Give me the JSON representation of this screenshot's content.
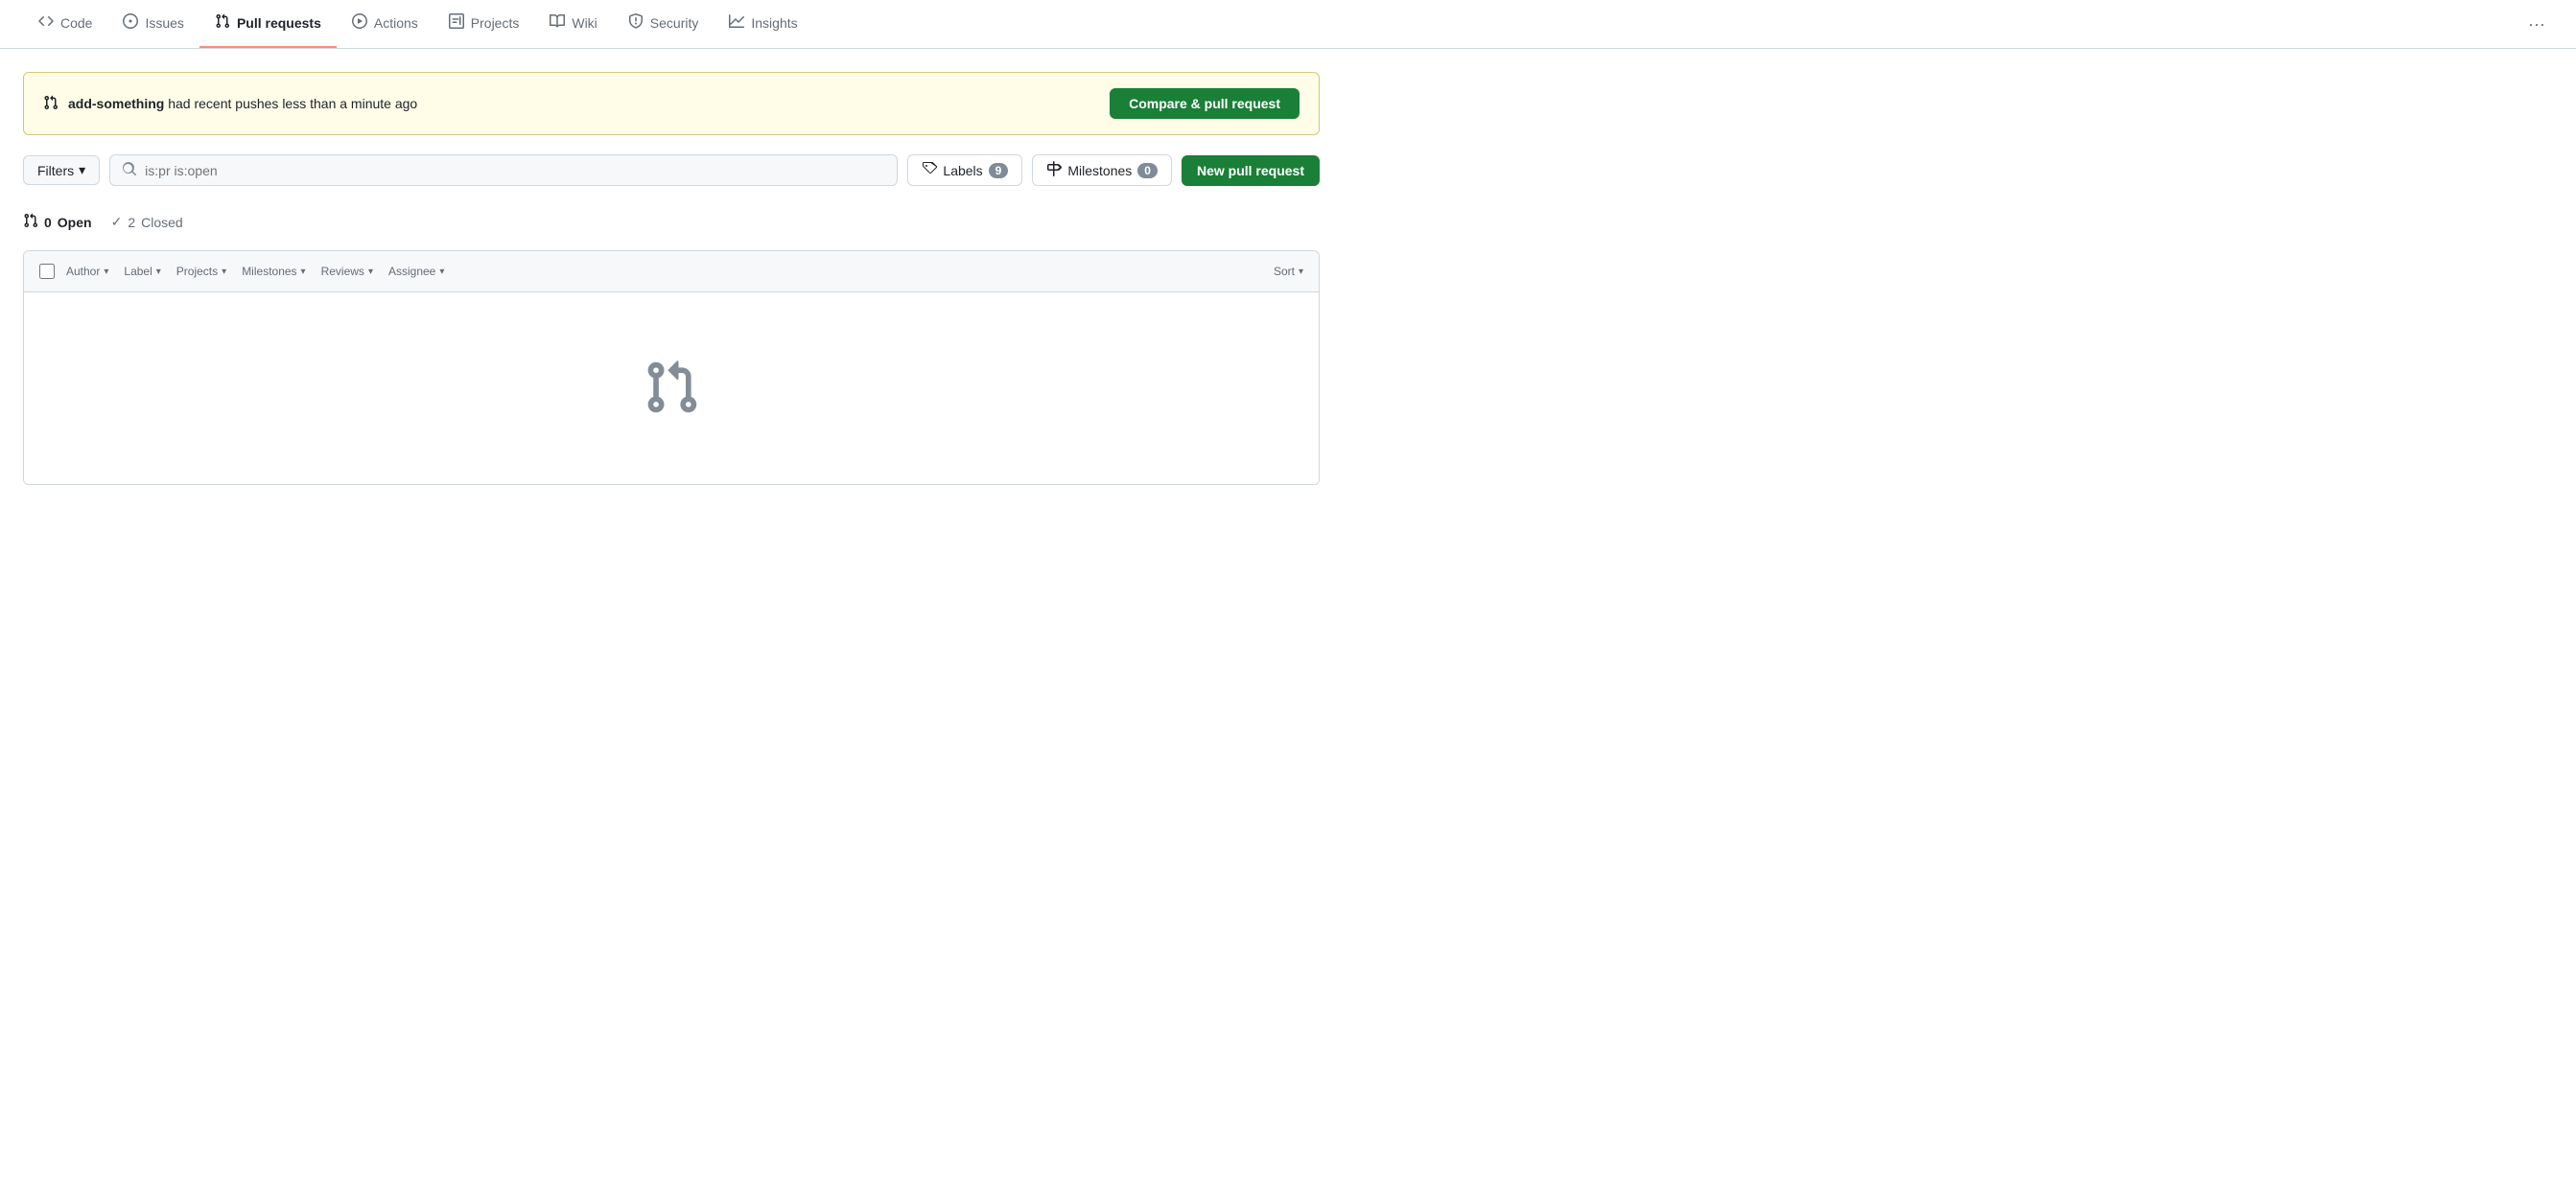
{
  "nav": {
    "tabs": [
      {
        "id": "code",
        "label": "Code",
        "icon": "<>",
        "active": false
      },
      {
        "id": "issues",
        "label": "Issues",
        "icon": "!",
        "active": false
      },
      {
        "id": "pull-requests",
        "label": "Pull requests",
        "icon": "pr",
        "active": true
      },
      {
        "id": "actions",
        "label": "Actions",
        "icon": "▷",
        "active": false
      },
      {
        "id": "projects",
        "label": "Projects",
        "icon": "▦",
        "active": false
      },
      {
        "id": "wiki",
        "label": "Wiki",
        "icon": "📖",
        "active": false
      },
      {
        "id": "security",
        "label": "Security",
        "icon": "🛡",
        "active": false
      },
      {
        "id": "insights",
        "label": "Insights",
        "icon": "📈",
        "active": false
      }
    ],
    "more_label": "···"
  },
  "banner": {
    "branch": "add-something",
    "message_prefix": " had recent pushes less than a minute ago",
    "compare_btn_label": "Compare & pull request"
  },
  "filter_bar": {
    "filters_label": "Filters",
    "search_placeholder": "is:pr is:open",
    "labels_label": "Labels",
    "labels_count": "9",
    "milestones_label": "Milestones",
    "milestones_count": "0",
    "new_pr_label": "New pull request"
  },
  "pr_status": {
    "open_count": "0",
    "open_label": "Open",
    "closed_count": "2",
    "closed_label": "Closed"
  },
  "pr_list_header": {
    "author_label": "Author",
    "label_label": "Label",
    "projects_label": "Projects",
    "milestones_label": "Milestones",
    "reviews_label": "Reviews",
    "assignee_label": "Assignee",
    "sort_label": "Sort"
  },
  "colors": {
    "active_tab_underline": "#fd8c73",
    "green_button": "#1a7f37",
    "banner_bg": "#fffce8",
    "banner_border": "#d4c77a"
  }
}
